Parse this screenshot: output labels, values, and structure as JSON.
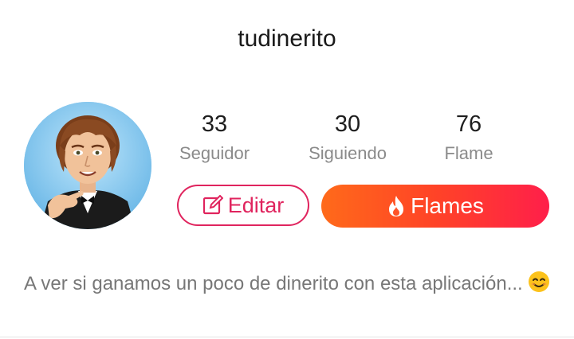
{
  "profile": {
    "username": "tudinerito",
    "avatar_icon": "bitmoji-avatar-icon",
    "bio": "A ver si ganamos un poco de dinerito con esta aplicación...",
    "bio_emoji": "smiling-face-emoji"
  },
  "stats": [
    {
      "value": "33",
      "label": "Seguidor"
    },
    {
      "value": "30",
      "label": "Siguiendo"
    },
    {
      "value": "76",
      "label": "Flame"
    }
  ],
  "actions": {
    "edit_label": "Editar",
    "edit_icon": "edit-icon",
    "flames_label": "Flames",
    "flames_icon": "flame-icon"
  },
  "colors": {
    "accent": "#e0245e",
    "gradient_start": "#ff6a1a",
    "gradient_end": "#ff1f4a",
    "text_muted": "#8a8a8a"
  }
}
